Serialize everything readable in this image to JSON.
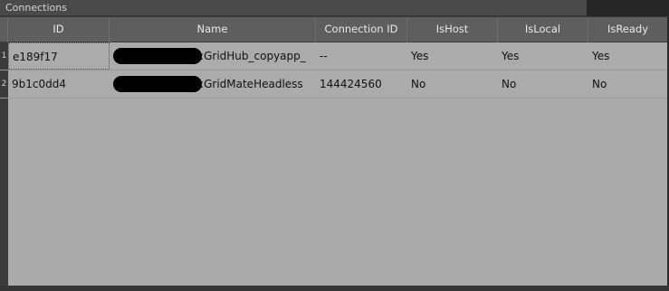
{
  "panel": {
    "tab_title": "Connections"
  },
  "table": {
    "columns": [
      "ID",
      "Name",
      "Connection ID",
      "IsHost",
      "IsLocal",
      "IsReady"
    ],
    "rows": [
      {
        "row_number": "1",
        "id": "e189f17",
        "name_suffix": "::GridHub_copyapp_",
        "connection_id": "--",
        "is_host": "Yes",
        "is_local": "Yes",
        "is_ready": "Yes"
      },
      {
        "row_number": "2",
        "id": "9b1c0dd4",
        "name_suffix": "::GridMateHeadless",
        "connection_id": "144424560",
        "is_host": "No",
        "is_local": "No",
        "is_ready": "No"
      }
    ]
  }
}
